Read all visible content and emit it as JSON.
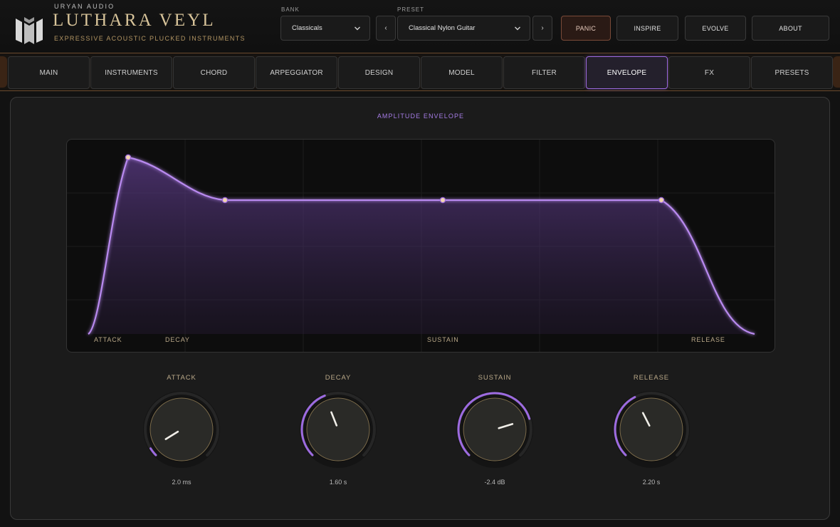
{
  "brand": {
    "company": "URYAN AUDIO",
    "title": "LUTHARA VEYL",
    "subtitle": "EXPRESSIVE ACOUSTIC PLUCKED INSTRUMENTS"
  },
  "bank": {
    "label": "BANK",
    "value": "Classicals"
  },
  "preset": {
    "label": "PRESET",
    "value": "Classical Nylon Guitar",
    "prev": "‹",
    "next": "›"
  },
  "buttons": {
    "panic": "PANIC",
    "inspire": "INSPIRE",
    "evolve": "EVOLVE",
    "about": "ABOUT"
  },
  "tabs": [
    "MAIN",
    "INSTRUMENTS",
    "CHORD",
    "ARPEGGIATOR",
    "DESIGN",
    "MODEL",
    "FILTER",
    "ENVELOPE",
    "FX",
    "PRESETS"
  ],
  "active_tab": 7,
  "envelope": {
    "title": "AMPLITUDE ENVELOPE",
    "stage_labels": {
      "attack": "ATTACK",
      "decay": "DECAY",
      "sustain": "SUSTAIN",
      "release": "RELEASE"
    }
  },
  "knobs": {
    "attack": {
      "label": "ATTACK",
      "value": "2.0 ms",
      "position": 0.05
    },
    "decay": {
      "label": "DECAY",
      "value": "1.60 s",
      "position": 0.42
    },
    "sustain": {
      "label": "SUSTAIN",
      "value": "-2.4 dB",
      "position": 0.77
    },
    "release": {
      "label": "RELEASE",
      "value": "2.20 s",
      "position": 0.4
    }
  },
  "colors": {
    "accent": "#9d6be0",
    "gold": "#d8c49a",
    "panic": "#7a4a38"
  }
}
